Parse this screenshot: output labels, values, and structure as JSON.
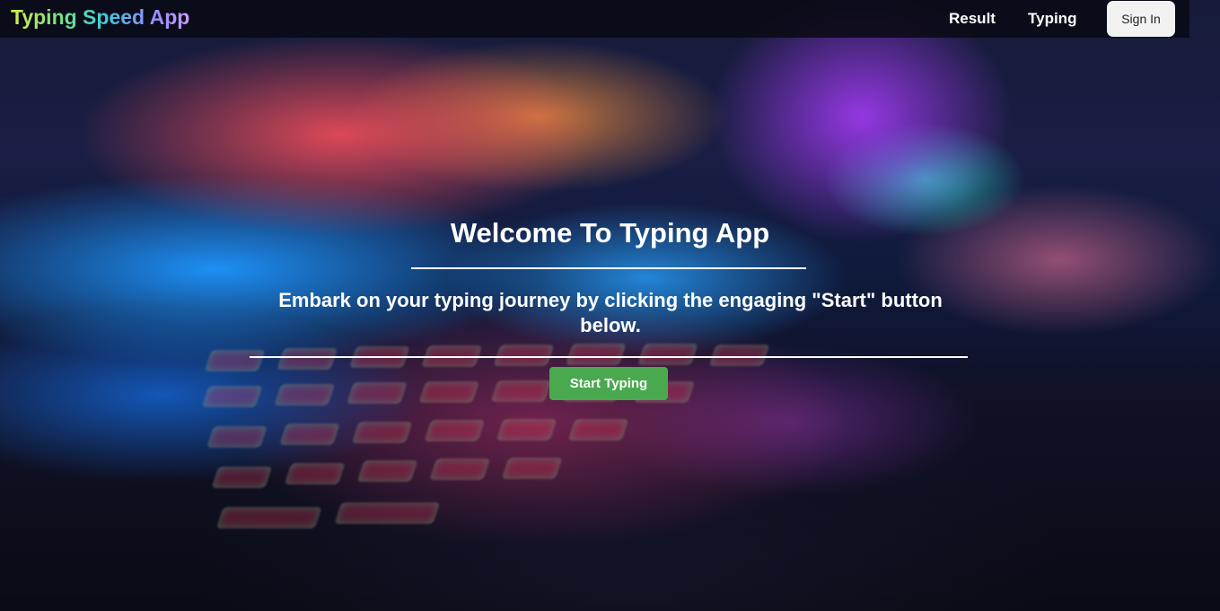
{
  "nav": {
    "brand": "Typing Speed App",
    "links": [
      {
        "label": "Result"
      },
      {
        "label": "Typing"
      }
    ],
    "signin_label": "Sign In"
  },
  "hero": {
    "title": "Welcome To Typing App",
    "subtitle": "Embark on your typing journey by clicking the engaging \"Start\" button below.",
    "cta_label": "Start Typing",
    "cta_color": "#4aa84f"
  },
  "background": {
    "description": "blurred-neon-keyboard-photo"
  }
}
